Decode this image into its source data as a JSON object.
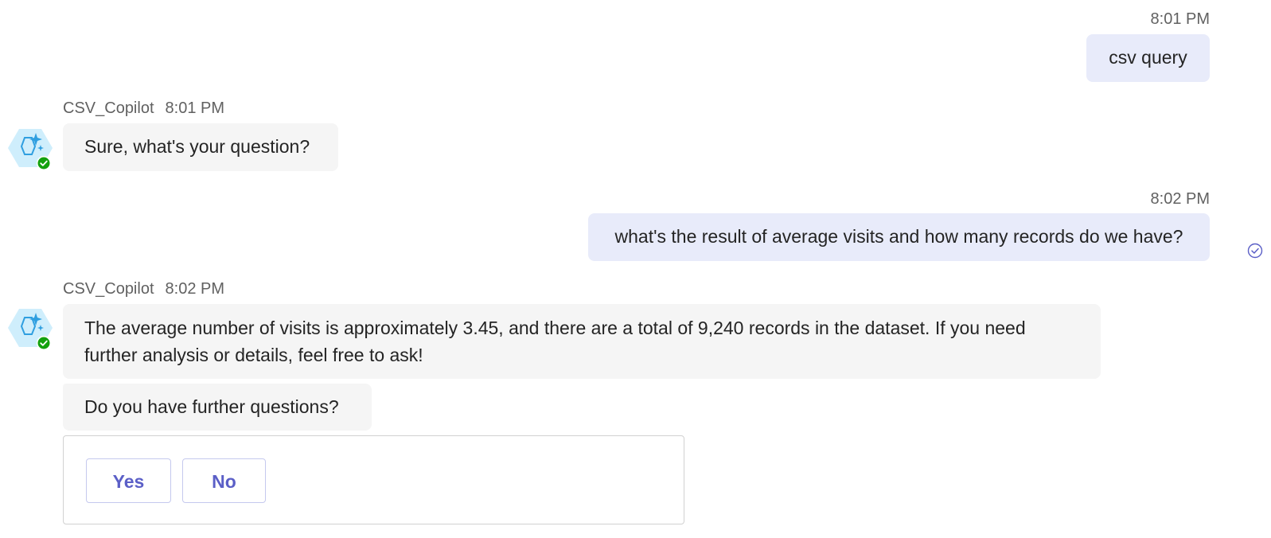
{
  "messages": {
    "m1": {
      "time": "8:01 PM",
      "text": "csv query"
    },
    "m2": {
      "sender": "CSV_Copilot",
      "time": "8:01 PM",
      "text": "Sure, what's your question?"
    },
    "m3": {
      "time": "8:02 PM",
      "text": "what's the result of average visits and how many records do we have?"
    },
    "m4": {
      "sender": "CSV_Copilot",
      "time": "8:02 PM",
      "text": "The average number of visits is approximately 3.45, and there are a total of 9,240 records in the dataset. If you need further analysis or details, feel free to ask!",
      "followup": "Do you have further questions?"
    }
  },
  "card": {
    "yes_label": "Yes",
    "no_label": "No"
  },
  "colors": {
    "user_bubble": "#e8ebfa",
    "bot_bubble": "#f5f5f5",
    "accent": "#5b5fc7",
    "status_green": "#13a10e"
  },
  "icons": {
    "bot_avatar": "copilot-hexagon-sparkle-icon",
    "presence": "available-check-icon",
    "read_receipt": "seen-check-circle-icon"
  }
}
